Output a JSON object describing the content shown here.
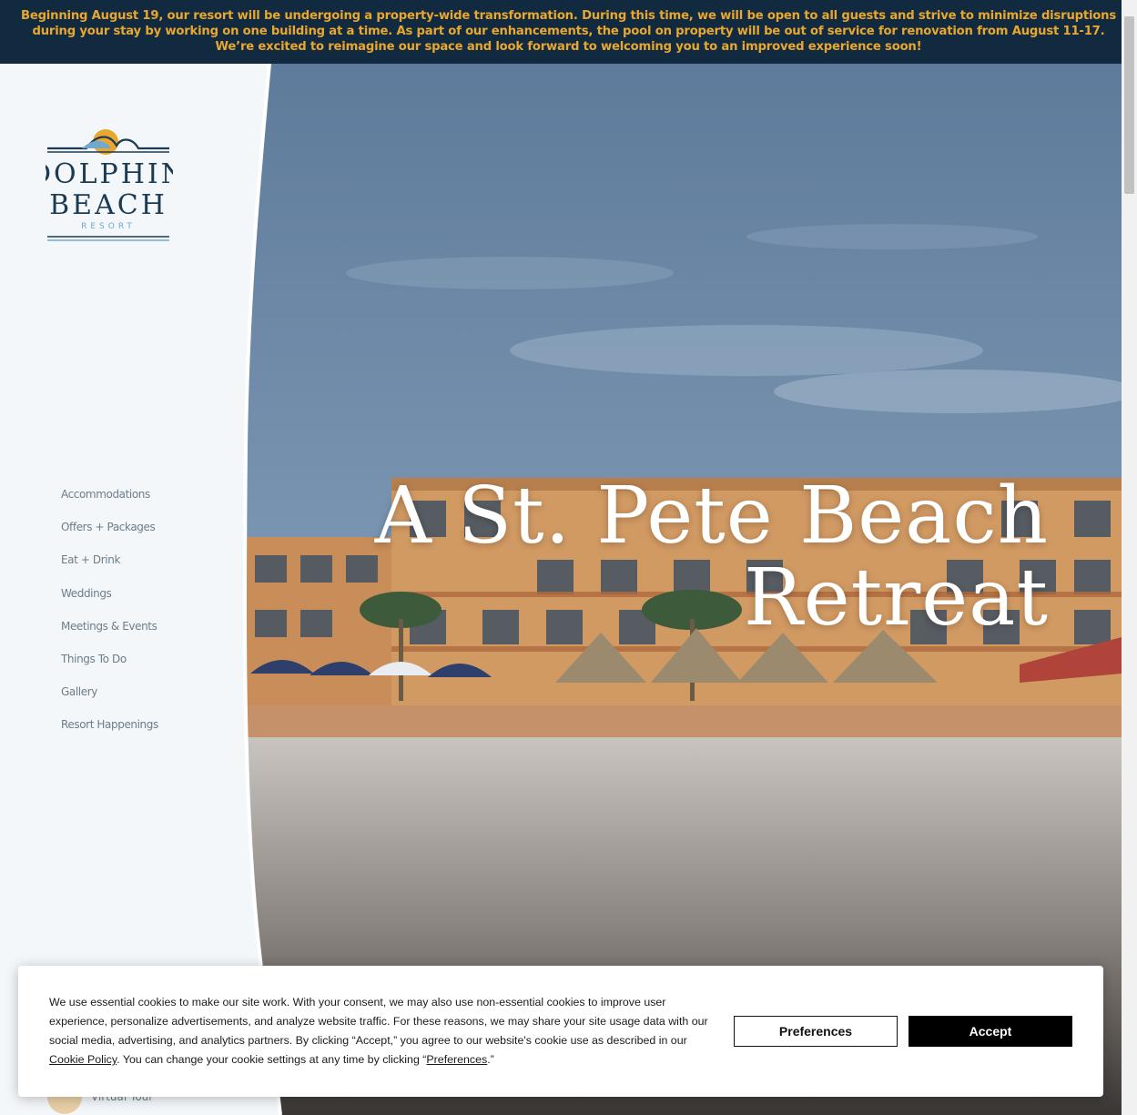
{
  "announcement": {
    "line1": "Beginning August 19, our resort will be undergoing a property-wide transformation. During this time, we will be open to all guests and strive to minimize disruptions",
    "line2": "during your stay by working on one building at a time. As part of our enhancements, the pool on property will be out of service for renovation from August 11-17.",
    "line3": "We’re excited to reimagine our space and look forward to welcoming you to an improved experience soon!"
  },
  "logo": {
    "line1": "DOLPHIN",
    "line2": "BEACH",
    "line3": "RESORT"
  },
  "nav": {
    "items": [
      {
        "label": "Accommodations"
      },
      {
        "label": "Offers + Packages"
      },
      {
        "label": "Eat + Drink"
      },
      {
        "label": "Weddings"
      },
      {
        "label": "Meetings & Events"
      },
      {
        "label": "Things To Do"
      },
      {
        "label": "Gallery"
      },
      {
        "label": "Resort Happenings"
      }
    ]
  },
  "hero": {
    "title_line1": "A St. Pete Beach",
    "title_line2": "Retreat"
  },
  "virtual_tour": {
    "label": "Virtual Tour"
  },
  "cookie": {
    "text_part1": "We use essential cookies to make our site work. With your consent, we may also use non-essential cookies to improve user experience, personalize advertisements, and analyze website traffic. For these reasons, we may share your site usage data with our social media, advertising, and analytics partners. By clicking “Accept,” you agree to our website's cookie use as described in our ",
    "policy_link": "Cookie Policy",
    "text_part2": ". You can change your cookie settings at any time by clicking “",
    "preferences_link": "Preferences",
    "text_part3": ".”",
    "preferences_button": "Preferences",
    "accept_button": "Accept"
  },
  "colors": {
    "banner_bg": "#122a3f",
    "banner_text": "#e8a72f",
    "logo_navy": "#1c3a52",
    "logo_sun": "#e8a72f",
    "logo_blue": "#6fa8d0",
    "nav_text": "#6e7d88"
  }
}
